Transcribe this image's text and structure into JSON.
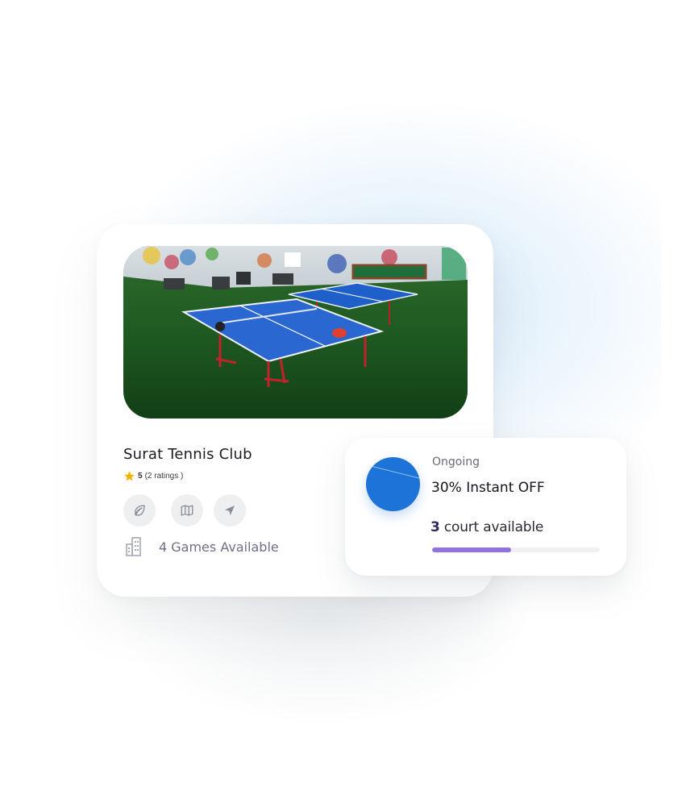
{
  "venue": {
    "name": "Surat Tennis Club",
    "rating": "5",
    "ratings_count": "(2 ratings )",
    "games_available": "4 Games Available",
    "actions": [
      {
        "icon": "leaf-icon"
      },
      {
        "icon": "map-icon"
      },
      {
        "icon": "navigation-arrow-icon"
      }
    ]
  },
  "offer": {
    "status": "Ongoing",
    "title": "30% Instant OFF",
    "court_count": "3",
    "court_label": " court available",
    "progress": 0.47,
    "progress_color": "#9272e3",
    "circle_color": "#1e73d8"
  },
  "colors": {
    "star": "#f5b301",
    "icon_gray": "#8a8d98"
  }
}
